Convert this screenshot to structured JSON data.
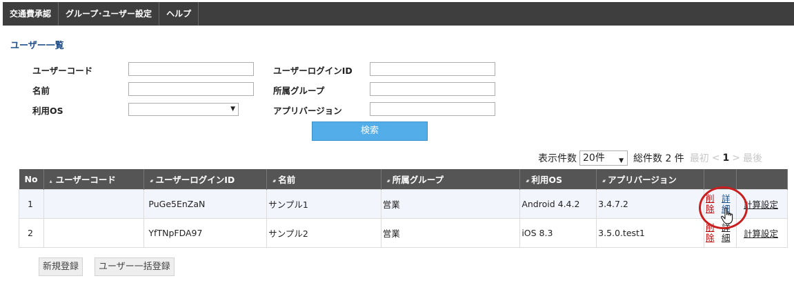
{
  "nav": {
    "items": [
      {
        "label": "交通費承認"
      },
      {
        "label": "グループ･ユーザー設定"
      },
      {
        "label": "ヘルプ"
      }
    ]
  },
  "page_title": "ユーザー一覧",
  "search": {
    "user_code_label": "ユーザーコード",
    "user_code_value": "",
    "login_id_label": "ユーザーログインID",
    "login_id_value": "",
    "name_label": "名前",
    "name_value": "",
    "group_label": "所属グループ",
    "group_value": "",
    "os_label": "利用OS",
    "os_value": "",
    "app_version_label": "アプリバージョン",
    "app_version_value": "",
    "search_button": "検索"
  },
  "pager": {
    "per_page_label": "表示件数",
    "per_page_value": "20件",
    "total_label": "総件数 2 件",
    "first": "最初",
    "prev": "<",
    "current": "1",
    "next": ">",
    "last": "最後"
  },
  "table": {
    "headers": {
      "no": "No",
      "user_code": "ユーザーコード",
      "login_id": "ユーザーログインID",
      "name": "名前",
      "group": "所属グループ",
      "os": "利用OS",
      "app_version": "アプリバージョン"
    },
    "rows": [
      {
        "no": "1",
        "user_code": "",
        "login_id": "PuGe5EnZaN",
        "name": "サンプル1",
        "group": "営業",
        "os": "Android 4.4.2",
        "app_version": "3.4.7.2",
        "delete": "削除",
        "detail": "詳細",
        "calc": "計算設定"
      },
      {
        "no": "2",
        "user_code": "",
        "login_id": "YfTNpFDA97",
        "name": "サンプル2",
        "group": "営業",
        "os": "iOS 8.3",
        "app_version": "3.5.0.test1",
        "delete": "削除",
        "detail": "詳細",
        "calc": "計算設定"
      }
    ]
  },
  "buttons": {
    "new_register": "新規登録",
    "bulk_register": "ユーザー一括登録"
  },
  "colors": {
    "nav_bg": "#3e3e3e",
    "title": "#1e4f8a",
    "search_button": "#53ade9",
    "header_bg": "#555555",
    "highlight": "#c81e1e"
  }
}
